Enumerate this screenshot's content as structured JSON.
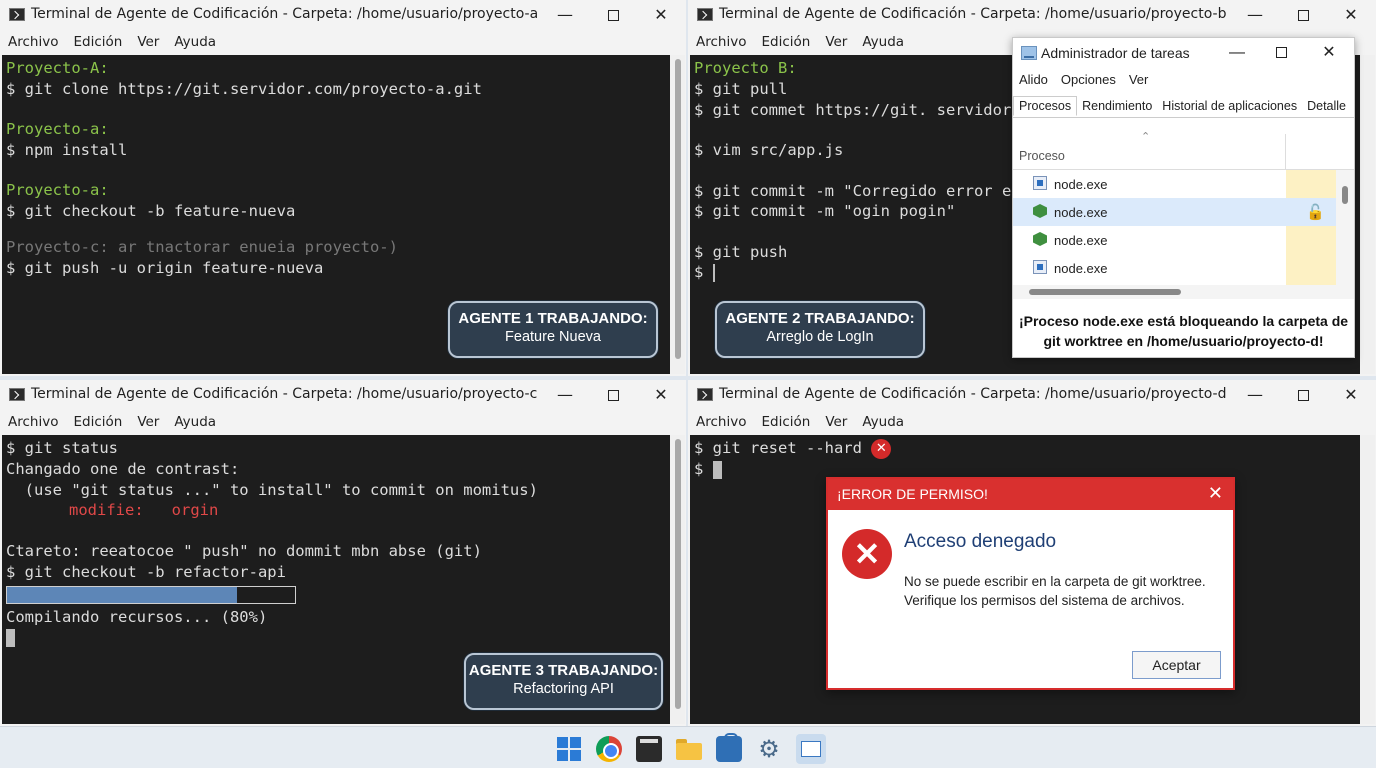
{
  "menu": [
    "Archivo",
    "Edición",
    "Ver",
    "Ayuda"
  ],
  "windows": {
    "a": {
      "title": "Terminal de Agente de Codificación - Carpeta: /home/usuario/proyecto-a",
      "lines": [
        "Proyecto-A:",
        "$ git clone https://git.servidor.com/proyecto-a.git",
        "Proyecto-a:",
        "$ npm install",
        "Proyecto-a:",
        "$ git checkout -b feature-nueva",
        "Proyecto-c: ar tnactorar enueia proyecto-)",
        "$ git push -u origin feature-nueva"
      ],
      "badge_title": "AGENTE 1 TRABAJANDO:",
      "badge_sub": "Feature Nueva"
    },
    "b": {
      "title": "Terminal de Agente de Codificación - Carpeta: /home/usuario/proyecto-b",
      "lines": [
        "Proyecto B:",
        "$ git pull",
        "$ git commet https://git. servidor",
        "$ vim src/app.js",
        "$ git commit -m \"Corregido error e",
        "$ git commit -m \"ogin pogin\"",
        "$ git push",
        "$"
      ],
      "badge_title": "AGENTE 2 TRABAJANDO:",
      "badge_sub": "Arreglo de LogIn"
    },
    "c": {
      "title": "Terminal de Agente de Codificación - Carpeta: /home/usuario/proyecto-c",
      "lines": [
        "$ git status",
        "Changado one de contrast:",
        "  (use \"git status ...\" to install\" to commit on momitus)",
        "modifie:   orgin",
        "Ctareto: reeatocoe \" push\" no dommit mbn abse (git)",
        "$ git checkout -b refactor-api",
        "Compilando recursos... (80%)"
      ],
      "progress": 0.8,
      "badge_title": "AGENTE 3 TRABAJANDO:",
      "badge_sub": "Refactoring API"
    },
    "d": {
      "title": "Terminal de Agente de Codificación - Carpeta: /home/usuario/proyecto-d",
      "lines": [
        "$ git reset --hard",
        "$"
      ]
    }
  },
  "task_manager": {
    "title": "Administrador de tareas",
    "menu": [
      "Alido",
      "Opciones",
      "Ver"
    ],
    "tabs": [
      "Procesos",
      "Rendimiento",
      "Historial de aplicaciones",
      "Detalle"
    ],
    "column": "Proceso",
    "processes": [
      "node.exe",
      "node.exe",
      "node.exe",
      "node.exe"
    ],
    "message_line1": "¡Proceso node.exe está bloqueando la carpeta de",
    "message_line2": "git worktree en /home/usuario/proyecto-d!"
  },
  "error_dialog": {
    "title": "¡ERROR DE PERMISO!",
    "heading": "Acceso denegado",
    "message_line1": "No se puede escribir en la carpeta de git worktree.",
    "message_line2": "Verifique los permisos del sistema de archivos.",
    "button": "Aceptar"
  },
  "colors": {
    "prompt_green": "#8bc34a",
    "error_red": "#d9302f",
    "terminal_bg": "#1d1d1d",
    "progress_fill": "#5d86b7"
  },
  "taskbar_icons": [
    "windows-start-icon",
    "chrome-icon",
    "terminal-icon",
    "folder-icon",
    "store-icon",
    "settings-gear-icon",
    "photos-icon"
  ]
}
